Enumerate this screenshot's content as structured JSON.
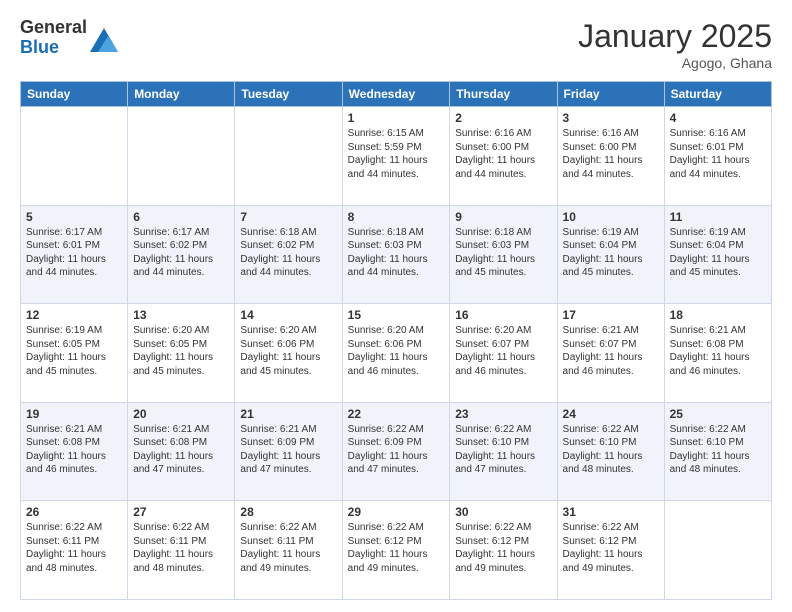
{
  "logo": {
    "general": "General",
    "blue": "Blue"
  },
  "header": {
    "month": "January 2025",
    "location": "Agogo, Ghana"
  },
  "weekdays": [
    "Sunday",
    "Monday",
    "Tuesday",
    "Wednesday",
    "Thursday",
    "Friday",
    "Saturday"
  ],
  "weeks": [
    [
      {
        "day": "",
        "info": ""
      },
      {
        "day": "",
        "info": ""
      },
      {
        "day": "",
        "info": ""
      },
      {
        "day": "1",
        "info": "Sunrise: 6:15 AM\nSunset: 5:59 PM\nDaylight: 11 hours and 44 minutes."
      },
      {
        "day": "2",
        "info": "Sunrise: 6:16 AM\nSunset: 6:00 PM\nDaylight: 11 hours and 44 minutes."
      },
      {
        "day": "3",
        "info": "Sunrise: 6:16 AM\nSunset: 6:00 PM\nDaylight: 11 hours and 44 minutes."
      },
      {
        "day": "4",
        "info": "Sunrise: 6:16 AM\nSunset: 6:01 PM\nDaylight: 11 hours and 44 minutes."
      }
    ],
    [
      {
        "day": "5",
        "info": "Sunrise: 6:17 AM\nSunset: 6:01 PM\nDaylight: 11 hours and 44 minutes."
      },
      {
        "day": "6",
        "info": "Sunrise: 6:17 AM\nSunset: 6:02 PM\nDaylight: 11 hours and 44 minutes."
      },
      {
        "day": "7",
        "info": "Sunrise: 6:18 AM\nSunset: 6:02 PM\nDaylight: 11 hours and 44 minutes."
      },
      {
        "day": "8",
        "info": "Sunrise: 6:18 AM\nSunset: 6:03 PM\nDaylight: 11 hours and 44 minutes."
      },
      {
        "day": "9",
        "info": "Sunrise: 6:18 AM\nSunset: 6:03 PM\nDaylight: 11 hours and 45 minutes."
      },
      {
        "day": "10",
        "info": "Sunrise: 6:19 AM\nSunset: 6:04 PM\nDaylight: 11 hours and 45 minutes."
      },
      {
        "day": "11",
        "info": "Sunrise: 6:19 AM\nSunset: 6:04 PM\nDaylight: 11 hours and 45 minutes."
      }
    ],
    [
      {
        "day": "12",
        "info": "Sunrise: 6:19 AM\nSunset: 6:05 PM\nDaylight: 11 hours and 45 minutes."
      },
      {
        "day": "13",
        "info": "Sunrise: 6:20 AM\nSunset: 6:05 PM\nDaylight: 11 hours and 45 minutes."
      },
      {
        "day": "14",
        "info": "Sunrise: 6:20 AM\nSunset: 6:06 PM\nDaylight: 11 hours and 45 minutes."
      },
      {
        "day": "15",
        "info": "Sunrise: 6:20 AM\nSunset: 6:06 PM\nDaylight: 11 hours and 46 minutes."
      },
      {
        "day": "16",
        "info": "Sunrise: 6:20 AM\nSunset: 6:07 PM\nDaylight: 11 hours and 46 minutes."
      },
      {
        "day": "17",
        "info": "Sunrise: 6:21 AM\nSunset: 6:07 PM\nDaylight: 11 hours and 46 minutes."
      },
      {
        "day": "18",
        "info": "Sunrise: 6:21 AM\nSunset: 6:08 PM\nDaylight: 11 hours and 46 minutes."
      }
    ],
    [
      {
        "day": "19",
        "info": "Sunrise: 6:21 AM\nSunset: 6:08 PM\nDaylight: 11 hours and 46 minutes."
      },
      {
        "day": "20",
        "info": "Sunrise: 6:21 AM\nSunset: 6:08 PM\nDaylight: 11 hours and 47 minutes."
      },
      {
        "day": "21",
        "info": "Sunrise: 6:21 AM\nSunset: 6:09 PM\nDaylight: 11 hours and 47 minutes."
      },
      {
        "day": "22",
        "info": "Sunrise: 6:22 AM\nSunset: 6:09 PM\nDaylight: 11 hours and 47 minutes."
      },
      {
        "day": "23",
        "info": "Sunrise: 6:22 AM\nSunset: 6:10 PM\nDaylight: 11 hours and 47 minutes."
      },
      {
        "day": "24",
        "info": "Sunrise: 6:22 AM\nSunset: 6:10 PM\nDaylight: 11 hours and 48 minutes."
      },
      {
        "day": "25",
        "info": "Sunrise: 6:22 AM\nSunset: 6:10 PM\nDaylight: 11 hours and 48 minutes."
      }
    ],
    [
      {
        "day": "26",
        "info": "Sunrise: 6:22 AM\nSunset: 6:11 PM\nDaylight: 11 hours and 48 minutes."
      },
      {
        "day": "27",
        "info": "Sunrise: 6:22 AM\nSunset: 6:11 PM\nDaylight: 11 hours and 48 minutes."
      },
      {
        "day": "28",
        "info": "Sunrise: 6:22 AM\nSunset: 6:11 PM\nDaylight: 11 hours and 49 minutes."
      },
      {
        "day": "29",
        "info": "Sunrise: 6:22 AM\nSunset: 6:12 PM\nDaylight: 11 hours and 49 minutes."
      },
      {
        "day": "30",
        "info": "Sunrise: 6:22 AM\nSunset: 6:12 PM\nDaylight: 11 hours and 49 minutes."
      },
      {
        "day": "31",
        "info": "Sunrise: 6:22 AM\nSunset: 6:12 PM\nDaylight: 11 hours and 49 minutes."
      },
      {
        "day": "",
        "info": ""
      }
    ]
  ]
}
